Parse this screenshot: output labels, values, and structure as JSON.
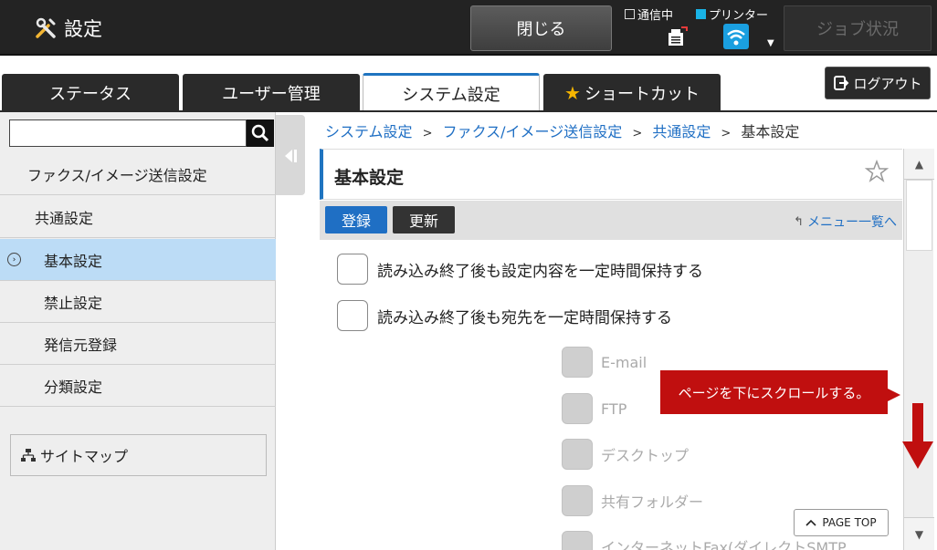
{
  "topbar": {
    "title": "設定",
    "close_label": "閉じる",
    "status": {
      "comm_label": "通信中",
      "printer_label": "プリンター"
    },
    "job_status_label": "ジョブ状況"
  },
  "tabs": [
    {
      "label": "ステータス"
    },
    {
      "label": "ユーザー管理"
    },
    {
      "label": "システム設定"
    },
    {
      "label": "ショートカット"
    }
  ],
  "logout_label": "ログアウト",
  "sidebar": {
    "search_value": "",
    "items": [
      {
        "label": "ファクス/イメージ送信設定"
      },
      {
        "label": "共通設定"
      },
      {
        "label": "基本設定"
      },
      {
        "label": "禁止設定"
      },
      {
        "label": "発信元登録"
      },
      {
        "label": "分類設定"
      }
    ],
    "sitemap_label": "サイトマップ"
  },
  "breadcrumb": {
    "items": [
      "システム設定",
      "ファクス/イメージ送信設定",
      "共通設定"
    ],
    "current": "基本設定",
    "separator": ">"
  },
  "page": {
    "title": "基本設定",
    "register_label": "登録",
    "update_label": "更新",
    "menu_link": "メニュー一覧へ"
  },
  "options": [
    {
      "label": "読み込み終了後も設定内容を一定時間保持する"
    },
    {
      "label": "読み込み終了後も宛先を一定時間保持する"
    }
  ],
  "sub_options": [
    {
      "label": "E-mail"
    },
    {
      "label": "FTP"
    },
    {
      "label": "デスクトップ"
    },
    {
      "label": "共有フォルダー"
    },
    {
      "label": "インターネットFax(ダイレクトSMTP"
    }
  ],
  "tooltip": "ページを下にスクロールする。",
  "page_top_label": "PAGE TOP",
  "colors": {
    "accent": "#1f74c0",
    "tooltip": "#c00f0f",
    "selected": "#bcdcf6"
  }
}
